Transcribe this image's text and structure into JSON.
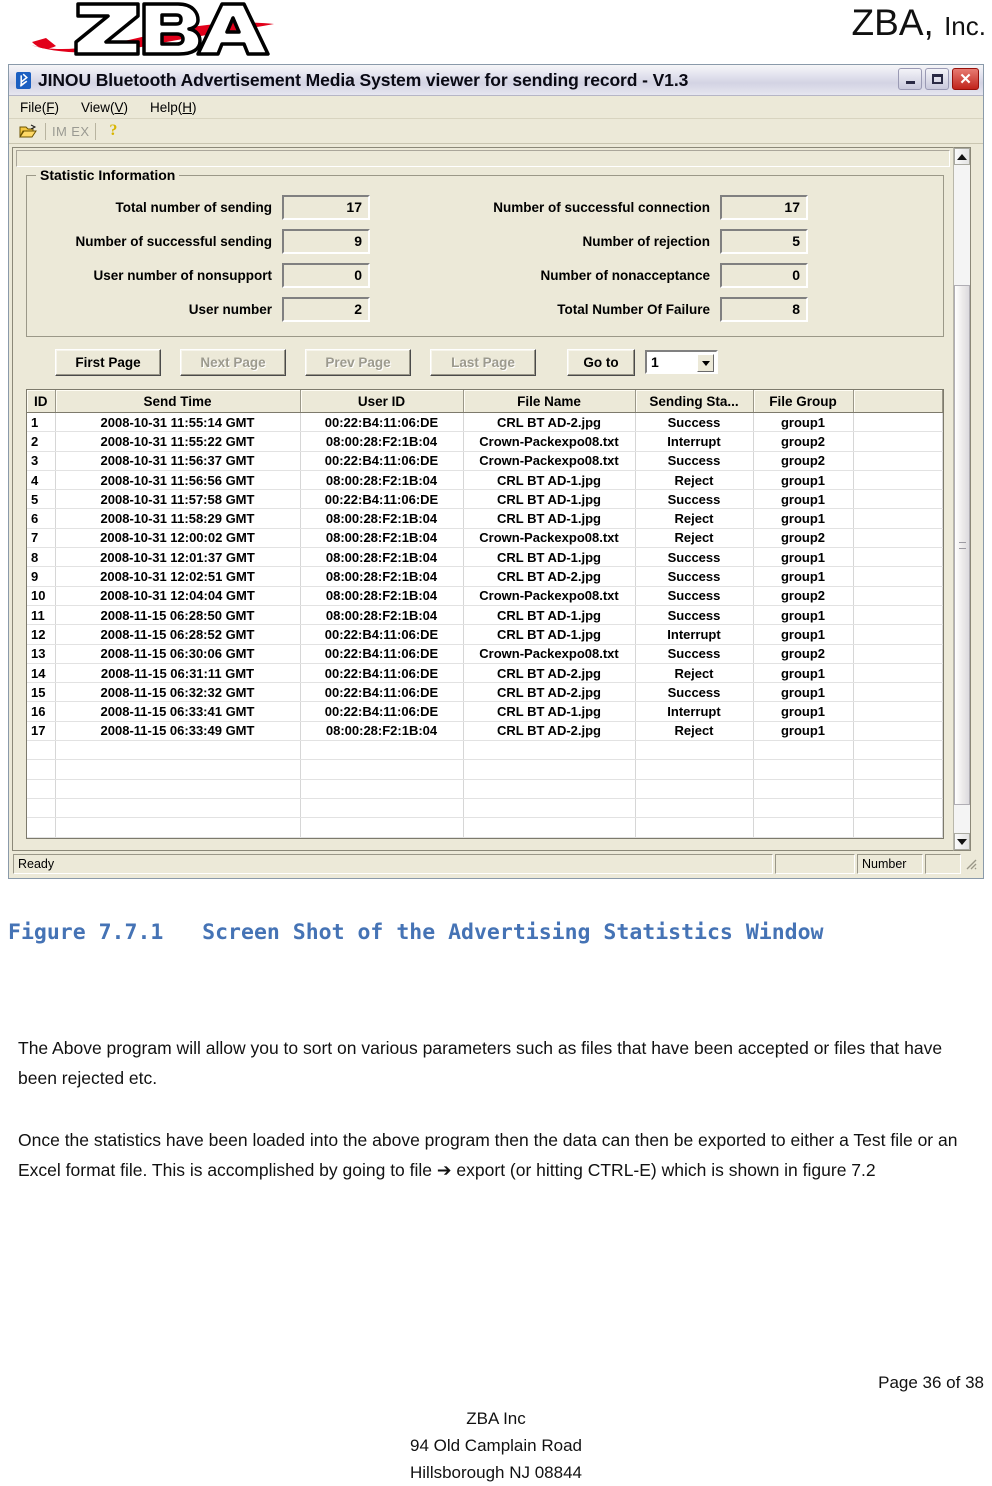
{
  "page_header": {
    "logo_text": "ZBA",
    "brand": "ZBA,",
    "brand_suffix": "Inc."
  },
  "window": {
    "title": "JINOU Bluetooth Advertisement Media System viewer for sending record - V1.3",
    "icon": "bluetooth-icon",
    "controls": {
      "minimize": "_",
      "maximize": "□",
      "close": "✕"
    }
  },
  "menubar": {
    "items": [
      {
        "label": "File(F)",
        "mnemonic": "F"
      },
      {
        "label": "View(V)",
        "mnemonic": "V"
      },
      {
        "label": "Help(H)",
        "mnemonic": "H"
      }
    ]
  },
  "toolbar": {
    "open_icon": "open-folder-icon",
    "import_label": "IM",
    "export_label": "EX",
    "help_label": "?"
  },
  "statistics": {
    "group_title": "Statistic Information",
    "rows": [
      {
        "left_label": "Total number of sending",
        "left_value": "17",
        "right_label": "Number of successful connection",
        "right_value": "17"
      },
      {
        "left_label": "Number of successful sending",
        "left_value": "9",
        "right_label": "Number of rejection",
        "right_value": "5"
      },
      {
        "left_label": "User number of nonsupport",
        "left_value": "0",
        "right_label": "Number of nonacceptance",
        "right_value": "0"
      },
      {
        "left_label": "User number",
        "left_value": "2",
        "right_label": "Total Number Of Failure",
        "right_value": "8"
      }
    ]
  },
  "pager": {
    "first_page": "First Page",
    "next_page": "Next Page",
    "prev_page": "Prev Page",
    "last_page": "Last Page",
    "goto_label": "Go to",
    "goto_value": "1"
  },
  "grid": {
    "columns": [
      "ID",
      "Send Time",
      "User ID",
      "File Name",
      "Sending Sta...",
      "File Group",
      ""
    ],
    "rows": [
      [
        "1",
        "2008-10-31 11:55:14 GMT",
        "00:22:B4:11:06:DE",
        "CRL BT AD-2.jpg",
        "Success",
        "group1",
        ""
      ],
      [
        "2",
        "2008-10-31 11:55:22 GMT",
        "08:00:28:F2:1B:04",
        "Crown-Packexpo08.txt",
        "Interrupt",
        "group2",
        ""
      ],
      [
        "3",
        "2008-10-31 11:56:37 GMT",
        "00:22:B4:11:06:DE",
        "Crown-Packexpo08.txt",
        "Success",
        "group2",
        ""
      ],
      [
        "4",
        "2008-10-31 11:56:56 GMT",
        "08:00:28:F2:1B:04",
        "CRL BT AD-1.jpg",
        "Reject",
        "group1",
        ""
      ],
      [
        "5",
        "2008-10-31 11:57:58 GMT",
        "00:22:B4:11:06:DE",
        "CRL BT AD-1.jpg",
        "Success",
        "group1",
        ""
      ],
      [
        "6",
        "2008-10-31 11:58:29 GMT",
        "08:00:28:F2:1B:04",
        "CRL BT AD-1.jpg",
        "Reject",
        "group1",
        ""
      ],
      [
        "7",
        "2008-10-31 12:00:02 GMT",
        "08:00:28:F2:1B:04",
        "Crown-Packexpo08.txt",
        "Reject",
        "group2",
        ""
      ],
      [
        "8",
        "2008-10-31 12:01:37 GMT",
        "08:00:28:F2:1B:04",
        "CRL BT AD-1.jpg",
        "Success",
        "group1",
        ""
      ],
      [
        "9",
        "2008-10-31 12:02:51 GMT",
        "08:00:28:F2:1B:04",
        "CRL BT AD-2.jpg",
        "Success",
        "group1",
        ""
      ],
      [
        "10",
        "2008-10-31 12:04:04 GMT",
        "08:00:28:F2:1B:04",
        "Crown-Packexpo08.txt",
        "Success",
        "group2",
        ""
      ],
      [
        "11",
        "2008-11-15 06:28:50 GMT",
        "08:00:28:F2:1B:04",
        "CRL BT AD-1.jpg",
        "Success",
        "group1",
        ""
      ],
      [
        "12",
        "2008-11-15 06:28:52 GMT",
        "00:22:B4:11:06:DE",
        "CRL BT AD-1.jpg",
        "Interrupt",
        "group1",
        ""
      ],
      [
        "13",
        "2008-11-15 06:30:06 GMT",
        "00:22:B4:11:06:DE",
        "Crown-Packexpo08.txt",
        "Success",
        "group2",
        ""
      ],
      [
        "14",
        "2008-11-15 06:31:11 GMT",
        "00:22:B4:11:06:DE",
        "CRL BT AD-2.jpg",
        "Reject",
        "group1",
        ""
      ],
      [
        "15",
        "2008-11-15 06:32:32 GMT",
        "00:22:B4:11:06:DE",
        "CRL BT AD-2.jpg",
        "Success",
        "group1",
        ""
      ],
      [
        "16",
        "2008-11-15 06:33:41 GMT",
        "00:22:B4:11:06:DE",
        "CRL BT AD-1.jpg",
        "Interrupt",
        "group1",
        ""
      ],
      [
        "17",
        "2008-11-15 06:33:49 GMT",
        "08:00:28:F2:1B:04",
        "CRL BT AD-2.jpg",
        "Reject",
        "group1",
        ""
      ]
    ],
    "empty_row_count": 5
  },
  "statusbar": {
    "ready": "Ready",
    "blank1": "",
    "number": "Number",
    "blank2": ""
  },
  "document": {
    "caption": "Figure 7.7.1   Screen Shot of the Advertising Statistics Window",
    "paragraph1": "The Above program will allow you to sort on various parameters such as files that have been accepted or files that have been rejected  etc.",
    "paragraph2": "Once the statistics have been loaded into the above program then the data can then be exported to either a Test file or an Excel format file. This is accomplished by going to file ➔ export (or hitting CTRL-E) which is shown in figure 7.2",
    "page_number": "Page 36 of 38",
    "footer_line1": "ZBA Inc",
    "footer_line2": "94 Old Camplain Road",
    "footer_line3": "Hillsborough NJ 08844"
  },
  "colors": {
    "caption_blue": "#4573b5",
    "logo_red": "#e2001a",
    "close_red": "#c0241c",
    "window_face": "#ece9d8"
  }
}
